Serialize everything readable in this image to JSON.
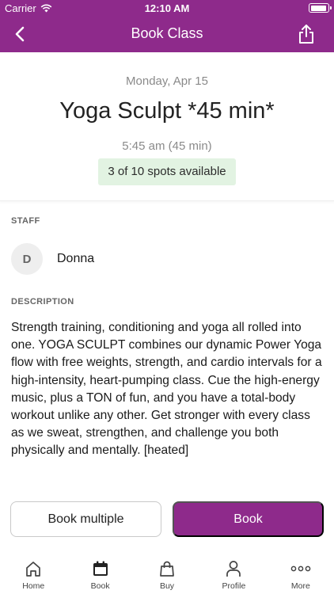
{
  "status_bar": {
    "carrier": "Carrier",
    "time": "12:10 AM"
  },
  "nav": {
    "title": "Book Class",
    "back_icon": "chevron-left-icon",
    "share_icon": "share-icon"
  },
  "class_info": {
    "date": "Monday, Apr 15",
    "name": "Yoga Sculpt *45 min*",
    "time": "5:45 am (45 min)",
    "spots": "3 of 10 spots available"
  },
  "staff": {
    "label": "STAFF",
    "initial": "D",
    "name": "Donna"
  },
  "description": {
    "label": "DESCRIPTION",
    "text": "Strength training, conditioning and yoga all rolled into one. YOGA SCULPT combines our dynamic Power Yoga flow with free weights, strength, and cardio intervals for a high-intensity, heart-pumping class. Cue the high-energy music, plus a TON of fun, and you have a total-body workout unlike any other. Get stronger with every class as we sweat, strengthen, and challenge you both physically and mentally. [heated]"
  },
  "actions": {
    "book_multiple": "Book multiple",
    "book": "Book"
  },
  "tabs": [
    {
      "label": "Home",
      "icon": "home-icon"
    },
    {
      "label": "Book",
      "icon": "calendar-icon"
    },
    {
      "label": "Buy",
      "icon": "shopping-bag-icon"
    },
    {
      "label": "Profile",
      "icon": "person-icon"
    },
    {
      "label": "More",
      "icon": "more-dots-icon"
    }
  ],
  "colors": {
    "brand": "#8e2a8b",
    "spots_bg": "#e2f3e2"
  }
}
